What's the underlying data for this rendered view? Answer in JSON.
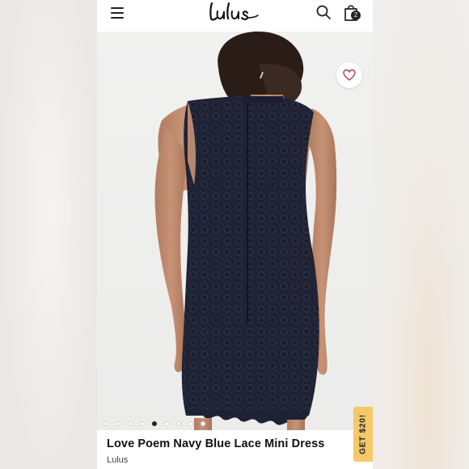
{
  "header": {
    "logo_text": "Lulus",
    "cart_count": "2",
    "icons": [
      "menu-icon",
      "search-icon",
      "shopping-bag-icon"
    ]
  },
  "product": {
    "title": "Love Poem Navy Blue Lace Mini Dress",
    "brand": "Lulus",
    "dress_color": "#1e2233",
    "gallery": {
      "image_count": 9,
      "active_index": 4
    }
  },
  "favorite": {
    "icon": "heart-icon",
    "color": "#b23a4a"
  },
  "promo": {
    "label": "GET $20!",
    "color": "#f5c86a"
  }
}
